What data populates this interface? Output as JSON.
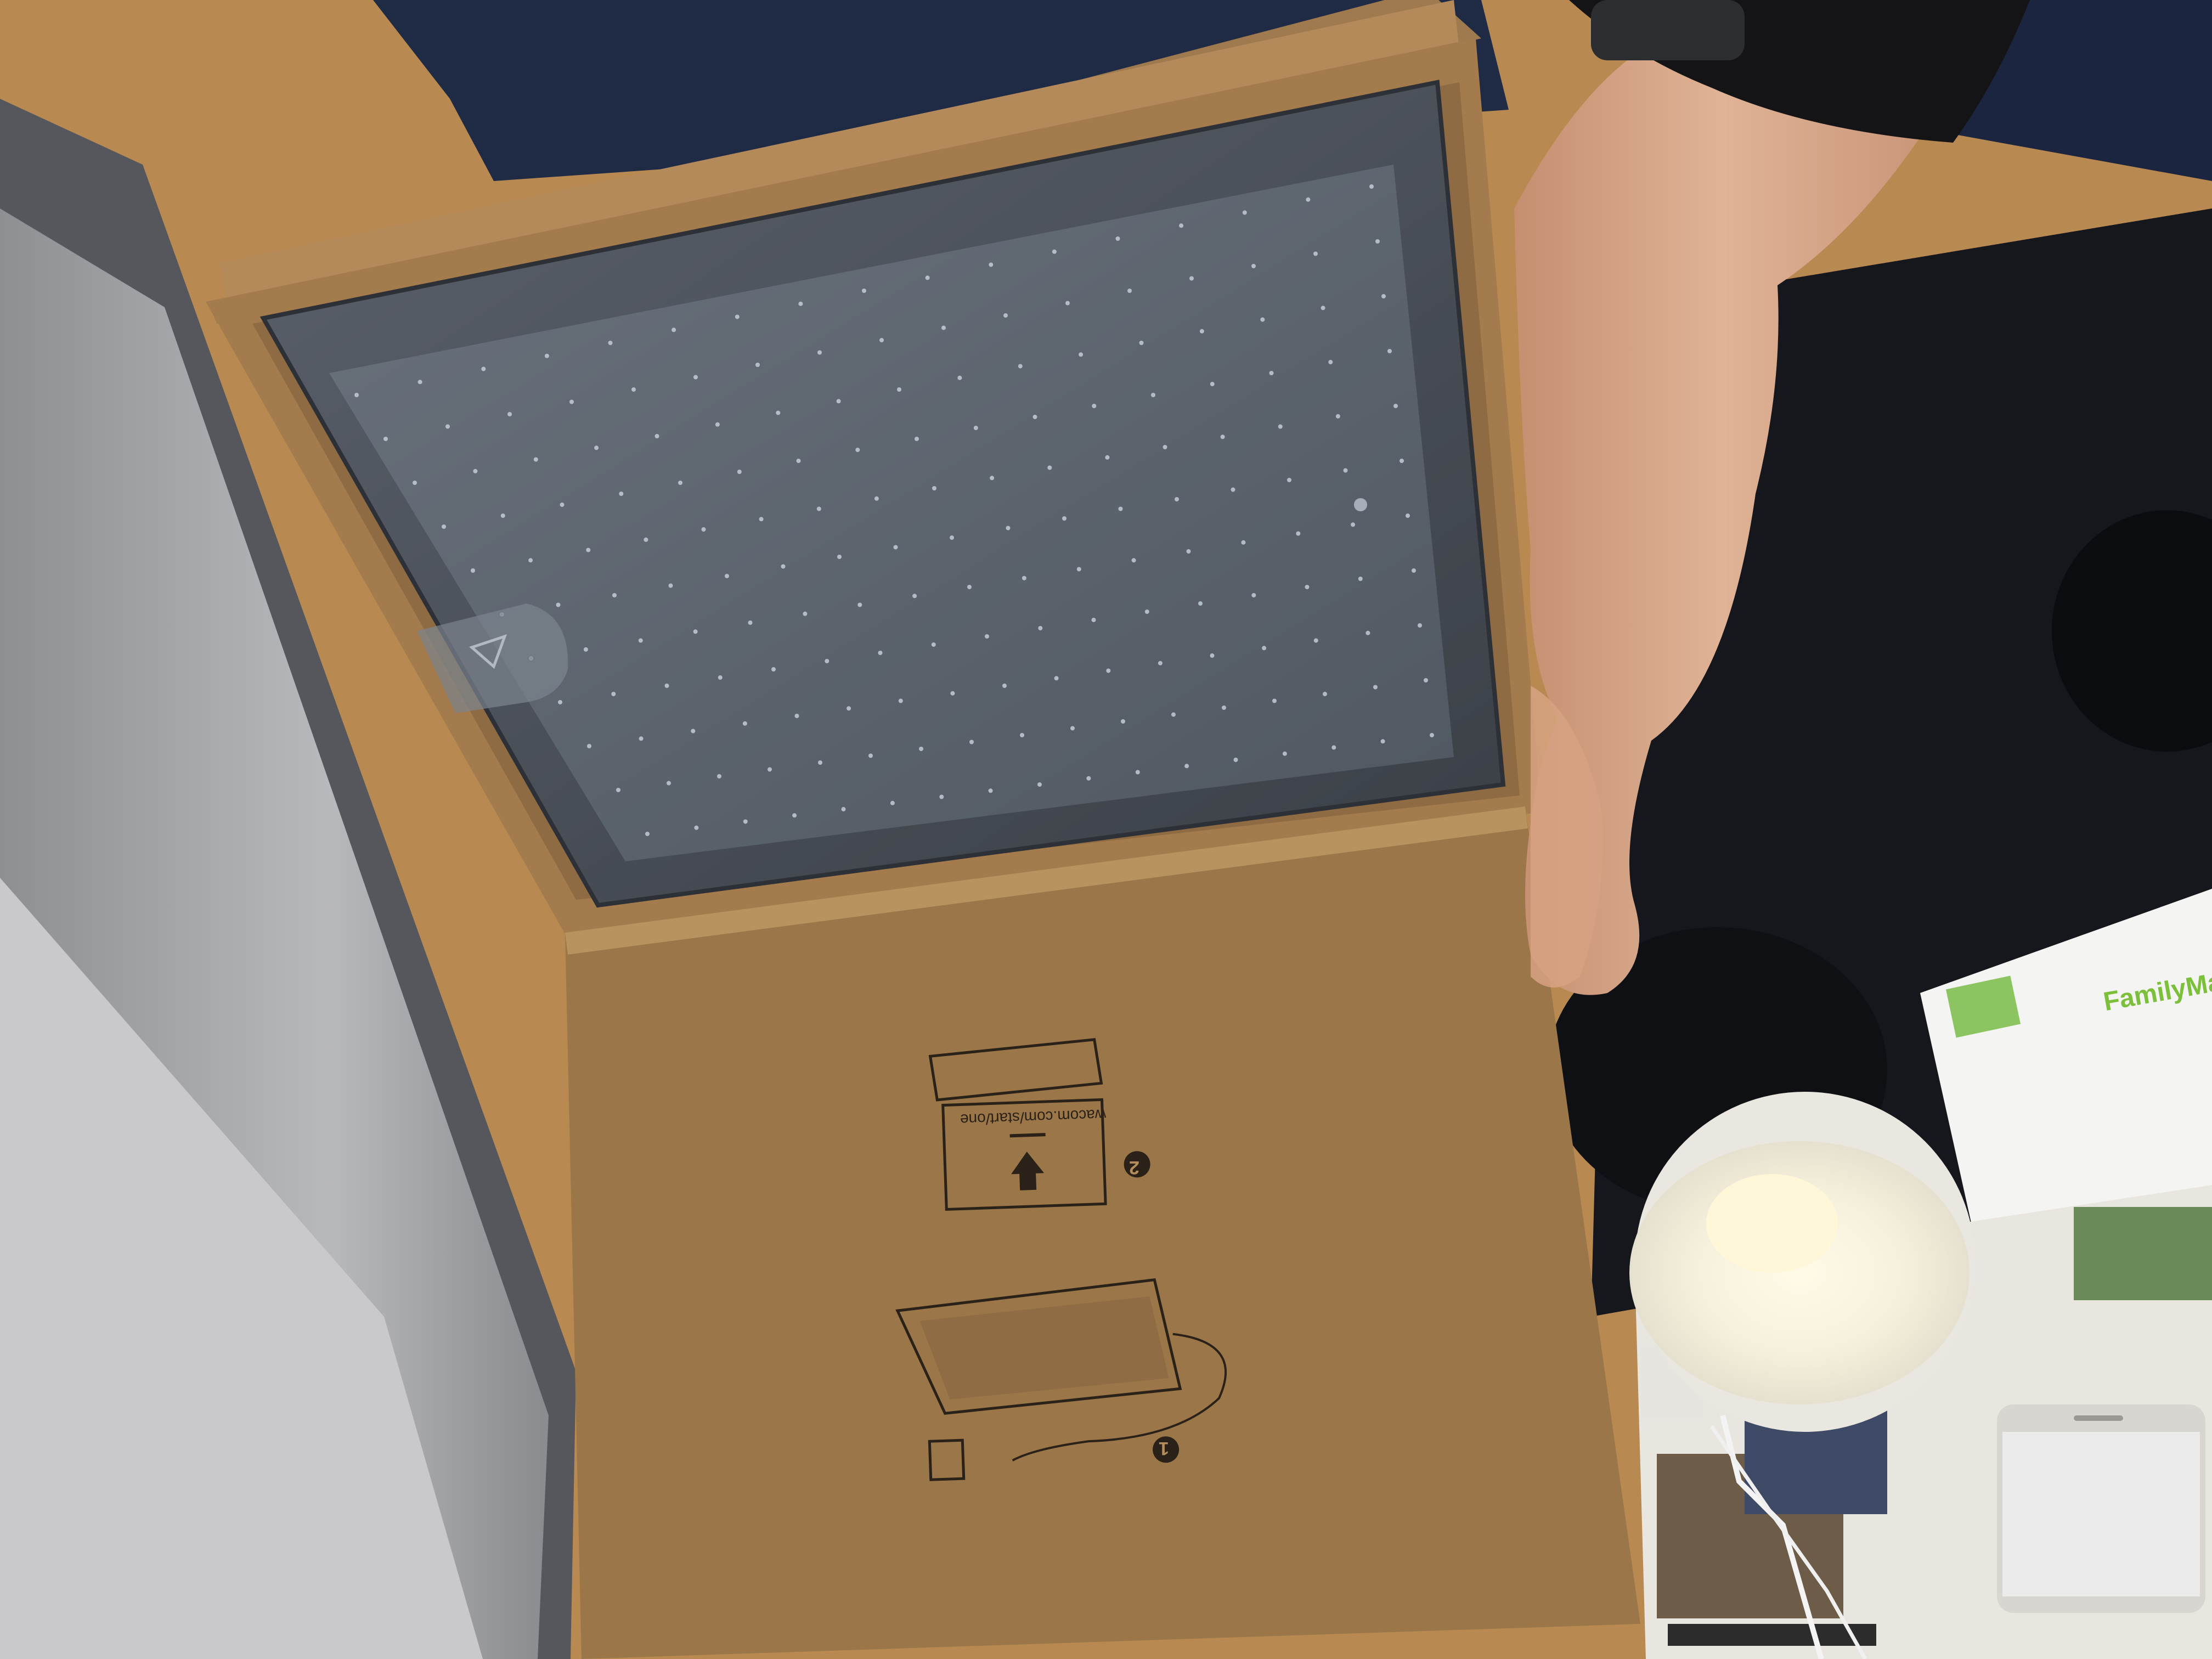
{
  "scene": {
    "description_tag": "photo",
    "colors": {
      "desk": "#b88a52",
      "monitor_bezel": "#a9a9ab",
      "monitor_frame_dark": "#55575c",
      "navy_shirt": "#1f2a44",
      "box_cardboard": "#a07a4f",
      "box_inner_lid": "#9b7a52",
      "tablet_body": "#4a4f57",
      "tablet_active_area": "#5d6570",
      "tablet_dots": "#c9d3dd",
      "skin": "#d8a98a",
      "dark_desk_surface": "#15171c",
      "lamp_white": "#f2f0ea",
      "paper_white": "#f4f4f2",
      "phone_silver": "#d9d6d2",
      "brand_green": "#7bbf3a"
    }
  },
  "box": {
    "url_text": "wacom.com/start/one",
    "step_1": "1",
    "step_2": "2"
  },
  "flyer": {
    "brand_text": "FamilyMa"
  }
}
